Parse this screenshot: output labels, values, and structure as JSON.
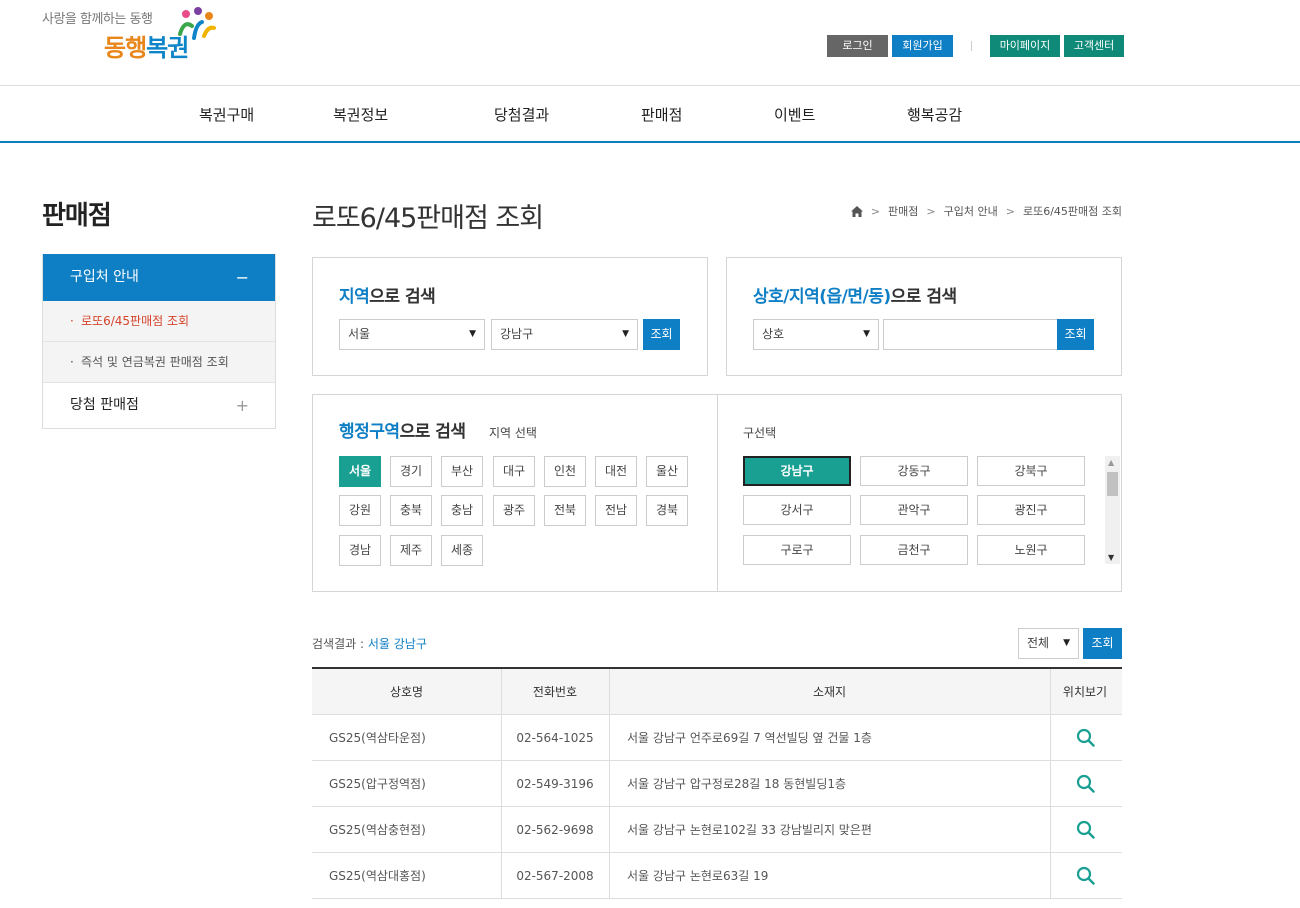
{
  "header": {
    "slogan": "사랑을 함께하는 동행",
    "brand_part1": "동행",
    "brand_part2": "복권",
    "util": {
      "login": "로그인",
      "join": "회원가입",
      "mypage": "마이페이지",
      "cs": "고객센터"
    }
  },
  "gnb": [
    "복권구매",
    "복권정보",
    "당첨결과",
    "판매점",
    "이벤트",
    "행복공감"
  ],
  "lnb": {
    "title": "판매점",
    "group1": "구입처 안내",
    "group1_toggle": "−",
    "sub1": "로또6/45판매점 조회",
    "sub2": "즉석 및 연금복권 판매점 조회",
    "sub_bullet": "·",
    "group2": "당첨 판매점",
    "group2_toggle": "+"
  },
  "page": {
    "title": "로또6/45판매점 조회",
    "breadcrumb": [
      "판매점",
      "구입처 안내",
      "로또6/45판매점 조회"
    ],
    "breadcrumb_sep": ">"
  },
  "search_region": {
    "title_hl": "지역",
    "title_rest": "으로 검색",
    "sido": "서울",
    "gugun": "강남구",
    "button": "조회"
  },
  "search_name": {
    "title_hl": "상호/지역(읍/면/동)",
    "title_rest": "으로 검색",
    "type": "상호",
    "query": "",
    "button": "조회"
  },
  "search_admin": {
    "title_hl": "행정구역",
    "title_rest": "으로 검색",
    "region_label": "지역 선택",
    "regions": [
      "서울",
      "경기",
      "부산",
      "대구",
      "인천",
      "대전",
      "울산",
      "강원",
      "충북",
      "충남",
      "광주",
      "전북",
      "전남",
      "경북",
      "경남",
      "제주",
      "세종"
    ],
    "selected_region": "서울",
    "gu_label": "구선택",
    "gu": [
      "강남구",
      "강동구",
      "강북구",
      "강서구",
      "관악구",
      "광진구",
      "구로구",
      "금천구",
      "노원구"
    ],
    "selected_gu": "강남구"
  },
  "result": {
    "label": "검색결과 : ",
    "value": "서울 강남구",
    "filter": "전체",
    "button": "조회"
  },
  "table": {
    "headers": [
      "상호명",
      "전화번호",
      "소재지",
      "위치보기"
    ],
    "rows": [
      [
        "GS25(역삼타운점)",
        "02-564-1025",
        "서울 강남구 언주로69길 7 역선빌딩 옆 건물 1층"
      ],
      [
        "GS25(압구정역점)",
        "02-549-3196",
        "서울 강남구 압구정로28길 18 동현빌딩1층"
      ],
      [
        "GS25(역삼충현점)",
        "02-562-9698",
        "서울 강남구 논현로102길 33 강남빌리지 맞은편"
      ],
      [
        "GS25(역삼대홍점)",
        "02-567-2008",
        "서울 강남구 논현로63길 19"
      ]
    ]
  },
  "colors": {
    "primary": "#0e7ec5",
    "teal": "#1a9f93",
    "dark_teal": "#0f8a78",
    "active_red": "#d5432c"
  }
}
